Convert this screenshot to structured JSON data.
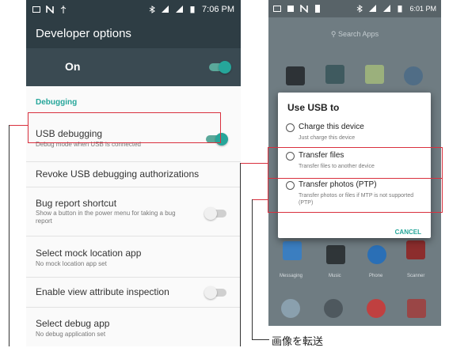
{
  "left_phone": {
    "status": {
      "time": "7:06 PM"
    },
    "toolbar": {
      "title": "Developer options"
    },
    "master": {
      "label": "On",
      "on": true
    },
    "section": "Debugging",
    "settings": [
      {
        "title": "USB debugging",
        "subtitle": "Debug mode when USB is connected",
        "switch": "on"
      },
      {
        "title": "Revoke USB debugging authorizations",
        "subtitle": ""
      },
      {
        "title": "Bug report shortcut",
        "subtitle": "Show a button in the power menu for taking a bug report",
        "switch": "off"
      },
      {
        "title": "Select mock location app",
        "subtitle": "No mock location app set"
      },
      {
        "title": "Enable view attribute inspection",
        "subtitle": "",
        "switch": "off"
      },
      {
        "title": "Select debug app",
        "subtitle": "No debug application set"
      }
    ]
  },
  "right_phone": {
    "status": {
      "time": "6:01 PM"
    },
    "search": {
      "label": "Search Apps"
    },
    "app_labels": [
      "Messaging",
      "Music",
      "Phone",
      "Scanner"
    ],
    "dialog": {
      "title": "Use USB to",
      "options": [
        {
          "label": "Charge this device",
          "desc": "Just charge this device"
        },
        {
          "label": "Transfer files",
          "desc": "Transfer files to another device"
        },
        {
          "label": "Transfer photos (PTP)",
          "desc": "Transfer photos or files if MTP is not supported (PTP)"
        }
      ],
      "cancel": "CANCEL"
    }
  },
  "annotation": {
    "caption": "画像を転送"
  },
  "colors": {
    "toolbar": "#2e3d44",
    "accent": "#26a69a",
    "highlight": "#d9303e"
  }
}
